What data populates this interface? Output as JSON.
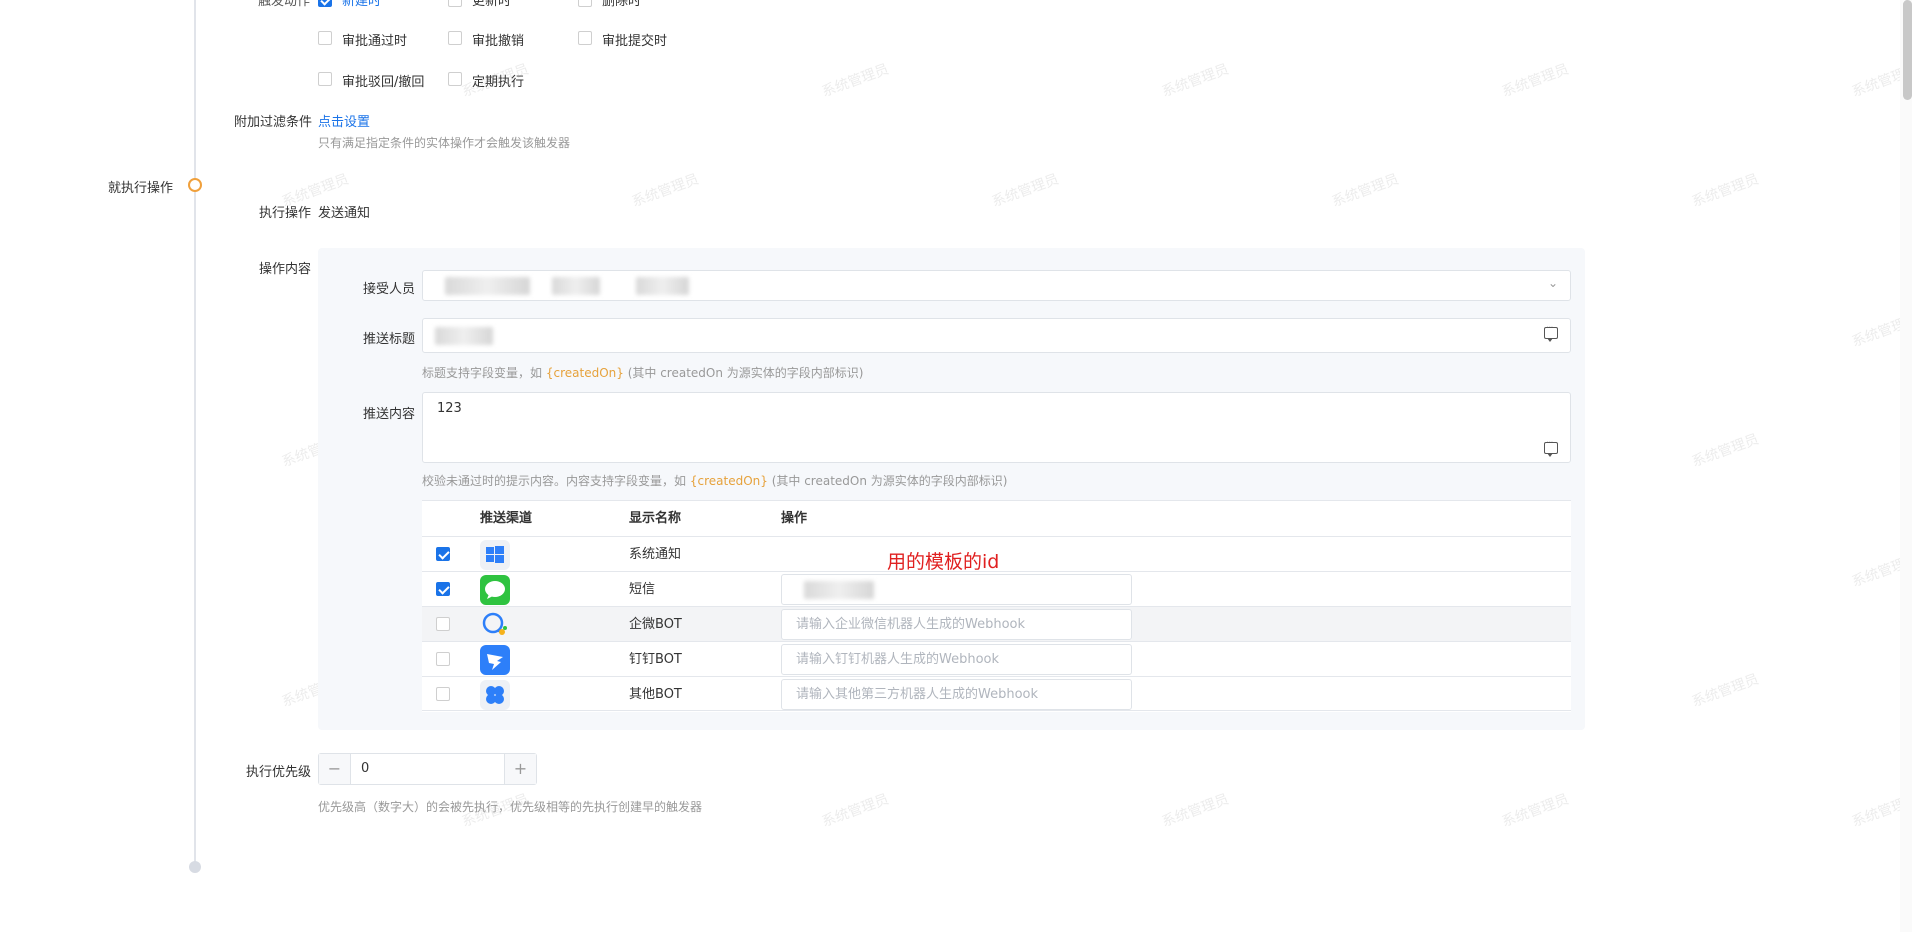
{
  "trigger": {
    "top_partial_labels": [
      "触发动作",
      "新建时",
      "更新时",
      "删除时"
    ],
    "checkboxes": [
      {
        "label": "审批通过时",
        "checked": false
      },
      {
        "label": "审批撤销",
        "checked": false
      },
      {
        "label": "审批提交时",
        "checked": false
      },
      {
        "label": "审批驳回/撤回",
        "checked": false
      },
      {
        "label": "定期执行",
        "checked": false
      }
    ],
    "filter_label": "附加过滤条件",
    "filter_link": "点击设置",
    "filter_hint": "只有满足指定条件的实体操作才会触发该触发器"
  },
  "section": {
    "title": "就执行操作"
  },
  "action": {
    "label": "执行操作",
    "value": "发送通知",
    "content_label": "操作内容"
  },
  "form": {
    "receiver_label": "接受人员",
    "title_label": "推送标题",
    "title_hint_pre": "标题支持字段变量，如",
    "title_hint_var": "{createdOn}",
    "title_hint_post": "(其中 createdOn 为源实体的字段内部标识)",
    "content_label": "推送内容",
    "content_value": "123",
    "content_hint_pre": "校验未通过时的提示内容。内容支持字段变量，如",
    "content_hint_var": "{createdOn}",
    "content_hint_post": "(其中 createdOn 为源实体的字段内部标识)"
  },
  "table": {
    "headers": {
      "channel": "推送渠道",
      "name": "显示名称",
      "action": "操作"
    },
    "rows": [
      {
        "name": "系统通知",
        "checked": true,
        "icon": "windows-icon",
        "placeholder": ""
      },
      {
        "name": "短信",
        "checked": true,
        "icon": "sms-icon",
        "placeholder": ""
      },
      {
        "name": "企微BOT",
        "checked": false,
        "icon": "wecom-icon",
        "placeholder": "请输入企业微信机器人生成的Webhook"
      },
      {
        "name": "钉钉BOT",
        "checked": false,
        "icon": "dingtalk-icon",
        "placeholder": "请输入钉钉机器人生成的Webhook"
      },
      {
        "name": "其他BOT",
        "checked": false,
        "icon": "other-bot-icon",
        "placeholder": "请输入其他第三方机器人生成的Webhook"
      }
    ]
  },
  "annotation": "用的模板的id",
  "priority": {
    "label": "执行优先级",
    "value": "0",
    "minus": "−",
    "plus": "+",
    "hint": "优先级高（数字大）的会被先执行，优先级相等的先执行创建早的触发器"
  },
  "watermark_text": "系统管理员",
  "colors": {
    "accent": "#1a73e8",
    "annotation": "#e02020",
    "variable": "#e6a23c"
  }
}
